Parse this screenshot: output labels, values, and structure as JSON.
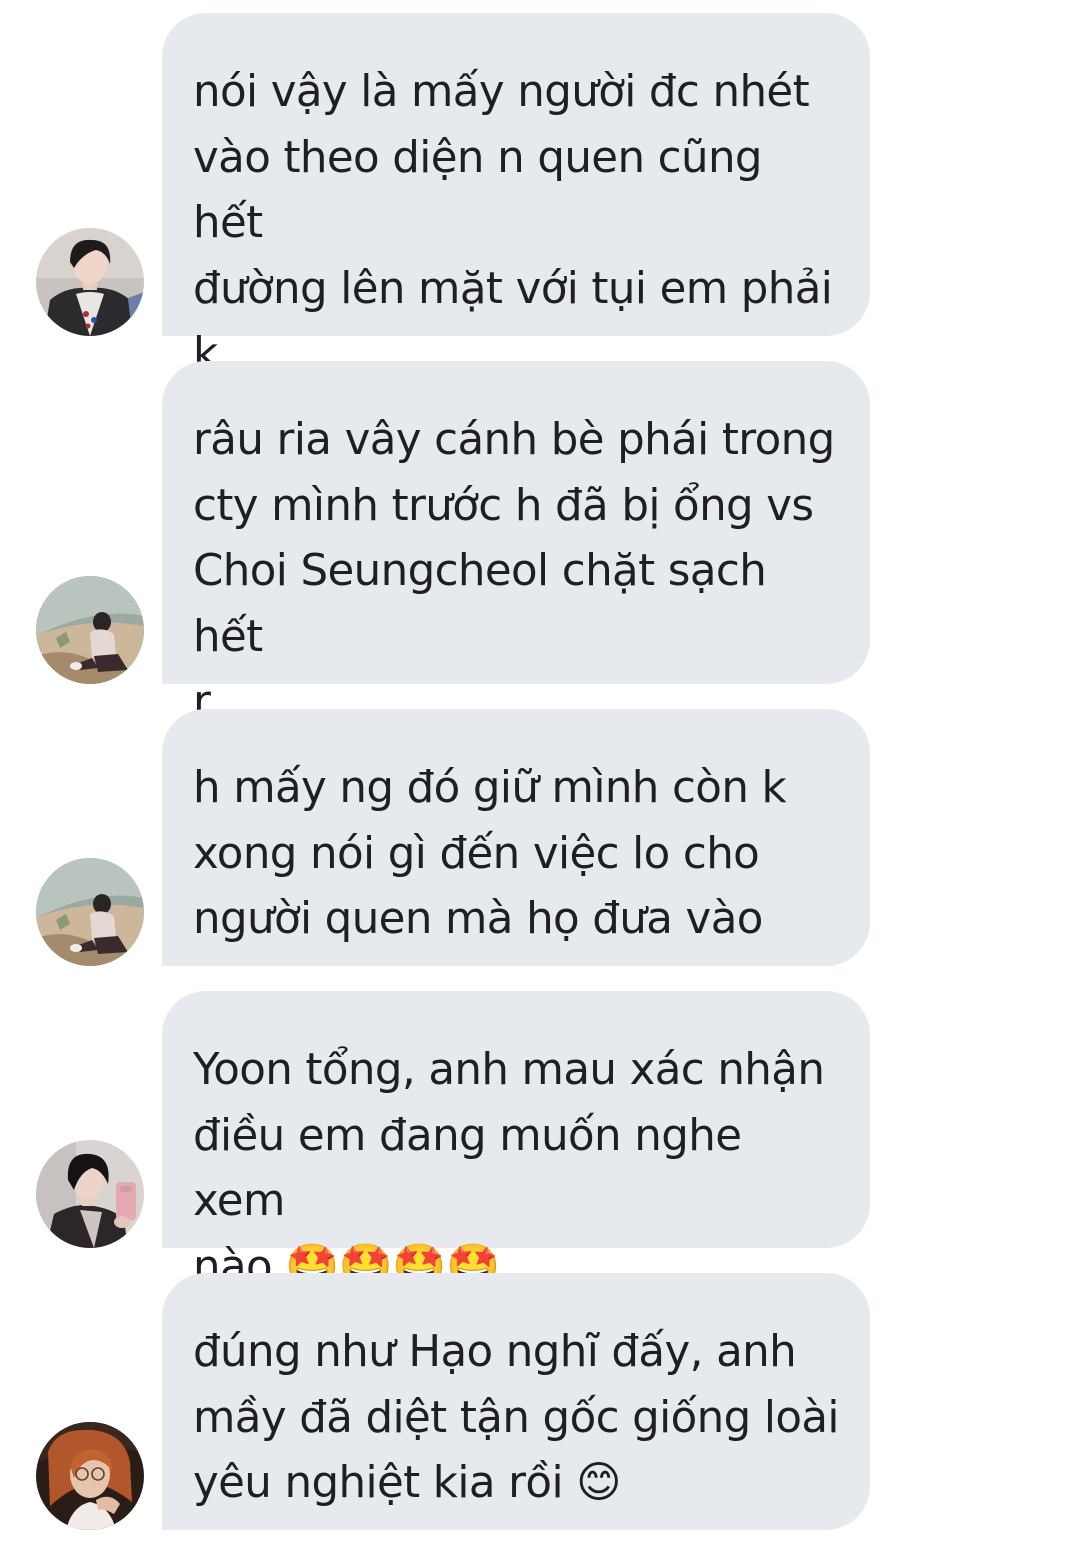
{
  "messages": [
    {
      "text": "nói vậy là mấy người đc nhét\nvào theo diện n quen cũng hết\nđường lên mặt với tụi em phải k\nanh 😳",
      "avatar": "avatar-short-dark-hair-jacket"
    },
    {
      "text": "râu ria vây cánh bè phái trong\ncty mình trước h đã bị ổng vs\nChoi Seungcheol chặt sạch hết\nr",
      "avatar": "avatar-person-sitting-on-rocks"
    },
    {
      "text": "h mấy ng đó giữ mình còn k\nxong nói gì đến việc lo cho\nngười quen mà họ đưa vào",
      "avatar": "avatar-person-sitting-on-rocks"
    },
    {
      "text": "Yoon tổng, anh mau xác nhận\nđiều em đang muốn nghe xem\nnào 🤩🤩🤩🤩",
      "avatar": "avatar-dark-hair-mirror-selfie"
    },
    {
      "text": "đúng như Hạo nghĩ đấy, anh\nmầy đã diệt tận gốc giống loài\nyêu nghiệt kia rồi 😊",
      "avatar": "avatar-red-hair-glasses"
    }
  ]
}
